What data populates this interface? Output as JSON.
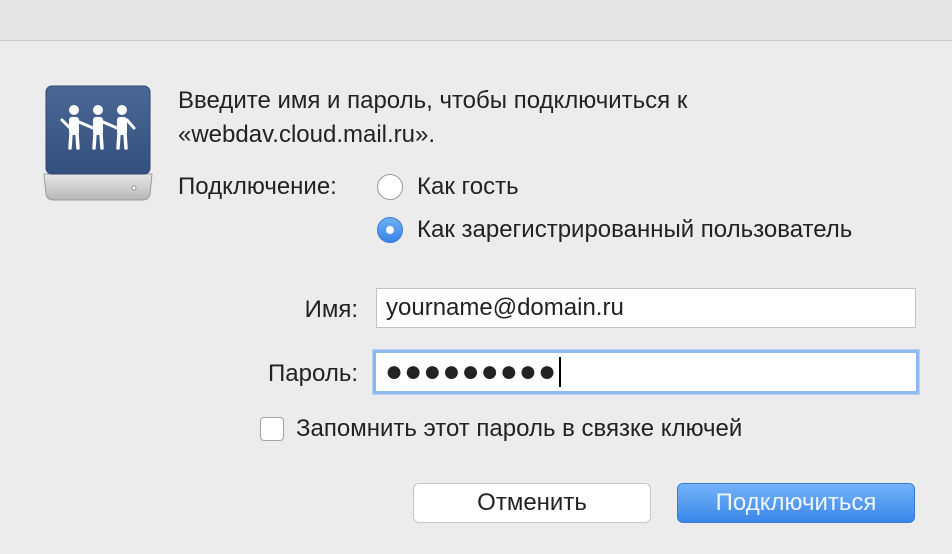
{
  "dialog": {
    "prompt_line1": "Введите имя и пароль, чтобы подключиться к",
    "prompt_line2": "«webdav.cloud.mail.ru».",
    "icon": "network-drive-icon"
  },
  "connection": {
    "label": "Подключение:",
    "options": [
      {
        "label": "Как гость",
        "selected": false
      },
      {
        "label": "Как зарегистрированный пользователь",
        "selected": true
      }
    ]
  },
  "fields": {
    "name_label": "Имя:",
    "name_value": "yourname@domain.ru",
    "password_label": "Пароль:",
    "password_value": "●●●●●●●●●"
  },
  "remember": {
    "label": "Запомнить этот пароль в связке ключей",
    "checked": false
  },
  "buttons": {
    "cancel": "Отменить",
    "connect": "Подключиться"
  },
  "colors": {
    "accent": "#3a86ea",
    "drive_panel": "#3d5a87"
  }
}
